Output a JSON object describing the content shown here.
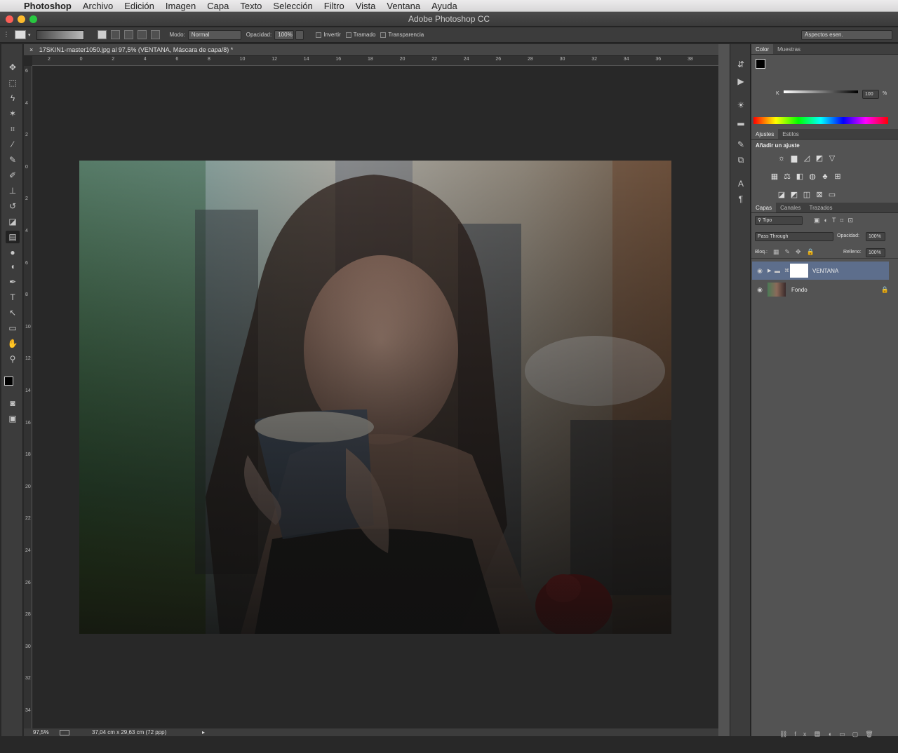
{
  "menubar": {
    "app": "Photoshop",
    "items": [
      "Archivo",
      "Edición",
      "Imagen",
      "Capa",
      "Texto",
      "Selección",
      "Filtro",
      "Vista",
      "Ventana",
      "Ayuda"
    ]
  },
  "window": {
    "title": "Adobe Photoshop CC"
  },
  "options": {
    "mode_label": "Modo:",
    "mode_value": "Normal",
    "opacity_label": "Opacidad:",
    "opacity_value": "100%",
    "invert": "Invertir",
    "dither": "Tramado",
    "transparency": "Transparencia",
    "workspace": "Aspectos esen."
  },
  "document": {
    "tab_title": "17SKIN1-master1050.jpg al 97,5% (VENTANA, Máscara de capa/8) *",
    "zoom": "97,5%",
    "doc_size": "37,04 cm x 29,63 cm (72 ppp)"
  },
  "ruler": {
    "h": [
      "2",
      "0",
      "2",
      "4",
      "6",
      "8",
      "10",
      "12",
      "14",
      "16",
      "18",
      "20",
      "22",
      "24",
      "26",
      "28",
      "30",
      "32",
      "34",
      "36",
      "38"
    ],
    "v": [
      "6",
      "4",
      "2",
      "0",
      "2",
      "4",
      "6",
      "8",
      "1 0",
      "1 2",
      "1 4",
      "1 6",
      "1 8",
      "2 0",
      "2 2",
      "2 4",
      "2 6",
      "2 8",
      "3 0",
      "3 2",
      "3 4"
    ]
  },
  "color_panel": {
    "tabs": [
      "Color",
      "Muestras"
    ],
    "k_label": "K",
    "k_value": "100",
    "pct": "%"
  },
  "adjust_panel": {
    "tabs": [
      "Ajustes",
      "Estilos"
    ],
    "add_label": "Añadir un ajuste"
  },
  "layers_panel": {
    "tabs": [
      "Capas",
      "Canales",
      "Trazados"
    ],
    "filter": "Tipo",
    "blend": "Pass Through",
    "opacity_label": "Opacidad:",
    "opacity": "100%",
    "lock_label": "Bloq.:",
    "fill_label": "Relleno:",
    "fill": "100%",
    "layers": [
      {
        "name": "VENTANA"
      },
      {
        "name": "Fondo"
      }
    ]
  },
  "colors": {
    "accent_selected": "#5d6e8c",
    "panel": "#535353"
  }
}
